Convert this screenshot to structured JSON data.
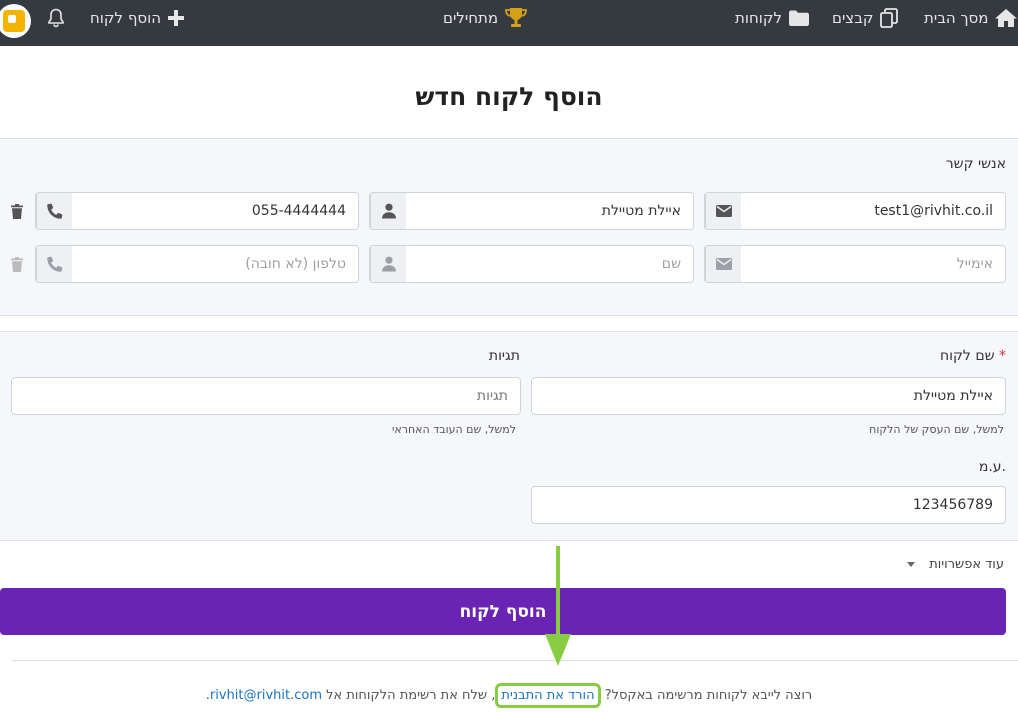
{
  "topbar": {
    "home_label": "מסך הבית",
    "files_label": "קבצים",
    "customers_label": "לקוחות",
    "beginners_label": "מתחילים",
    "add_customer_label": "הוסף לקוח",
    "bg_color": "#343a40"
  },
  "page": {
    "title": "הוסף לקוח חדש"
  },
  "contacts": {
    "label": "אנשי קשר",
    "rows": [
      {
        "email_value": "test1@rivhit.co.il",
        "email_placeholder": "אימייל",
        "name_value": "איילת מטיילת",
        "name_placeholder": "שם",
        "phone_value": "055-4444444",
        "phone_placeholder": "טלפון (לא חובה)"
      },
      {
        "email_value": "",
        "email_placeholder": "אימייל",
        "name_value": "",
        "name_placeholder": "שם",
        "phone_value": "",
        "phone_placeholder": "טלפון (לא חובה)"
      }
    ]
  },
  "customer": {
    "name_label": "שם לקוח",
    "required_mark": "*",
    "name_value": "איילת מטיילת",
    "name_hint": "למשל, שם העסק של הלקוח",
    "tags_label": "תגיות",
    "tags_placeholder": "תגיות",
    "tags_hint": "למשל, שם העובד האחראי",
    "vat_label": "ע.מ.",
    "vat_value": "123456789"
  },
  "more_options_label": "עוד אפשרויות",
  "submit_label": "הוסף לקוח",
  "submit_color": "#6a24b3",
  "footer": {
    "text_before": "רוצה לייבא לקוחות מרשימה באקסל? ",
    "link_template": "הורד את התבנית",
    "text_middle": ", שלח את רשימת הלקוחות אל ",
    "email_link": "rivhit@rivhit.com",
    "text_end": ".",
    "highlight_color": "#88cc44"
  }
}
